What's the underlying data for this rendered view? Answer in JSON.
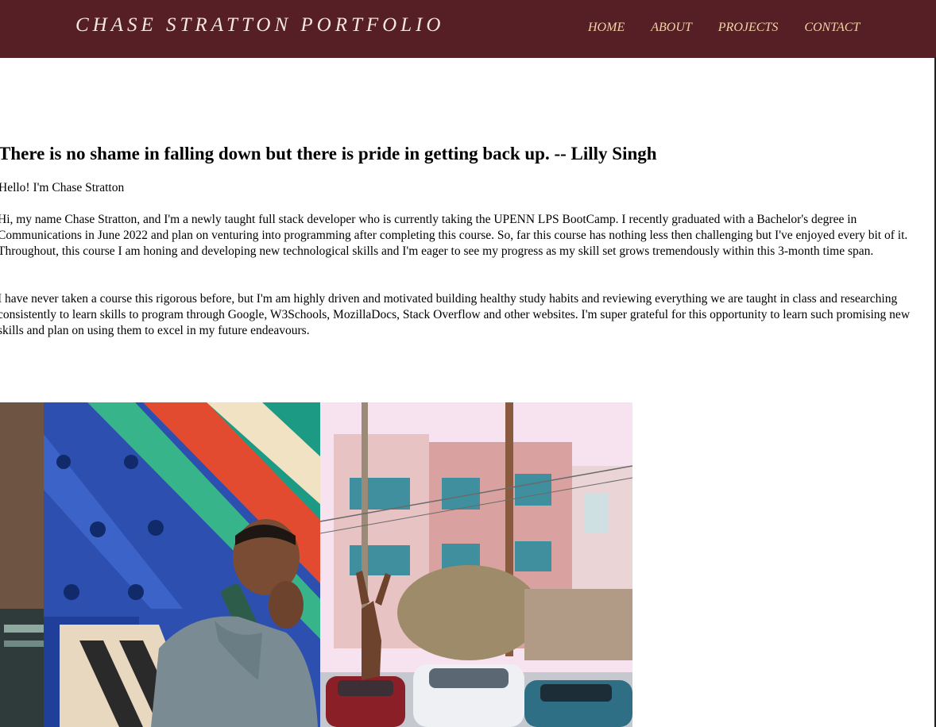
{
  "header": {
    "site_title": "CHASE STRATTON PORTFOLIO",
    "nav": [
      {
        "label": "HOME"
      },
      {
        "label": "ABOUT"
      },
      {
        "label": "PROJECTS"
      },
      {
        "label": "CONTACT"
      }
    ]
  },
  "about": {
    "quote": "There is no shame in falling down but there is pride in getting back up. -- Lilly Singh",
    "greeting": "Hello! I'm Chase Stratton",
    "paragraphs": [
      "Hi, my name Chase Stratton, and I'm a newly taught full stack developer who is currently taking the UPENN LPS BootCamp. I recently graduated with a Bachelor's degree in Communications in June 2022 and plan on venturing into programming after completing this course. So, far this course has nothing less then challenging but I've enjoyed every bit of it. Throughout, this course I am honing and developing new technological skills and I'm eager to see my progress as my skill set grows tremendously within this 3-month time span.",
      "I have never taken a course this rigorous before, but I'm am highly driven and motivated building healthy study habits and reviewing everything we are taught in class and researching consistently to learn skills to program through Google, W3Schools, MozillaDocs, Stack Overflow and other websites. I'm super grateful for this opportunity to learn such promising new skills and plan on using them to excel in my future endeavours."
    ]
  },
  "colors": {
    "header_bg": "#561f25",
    "title_text": "#f5e9dc",
    "nav_text": "#f2d3a8"
  }
}
